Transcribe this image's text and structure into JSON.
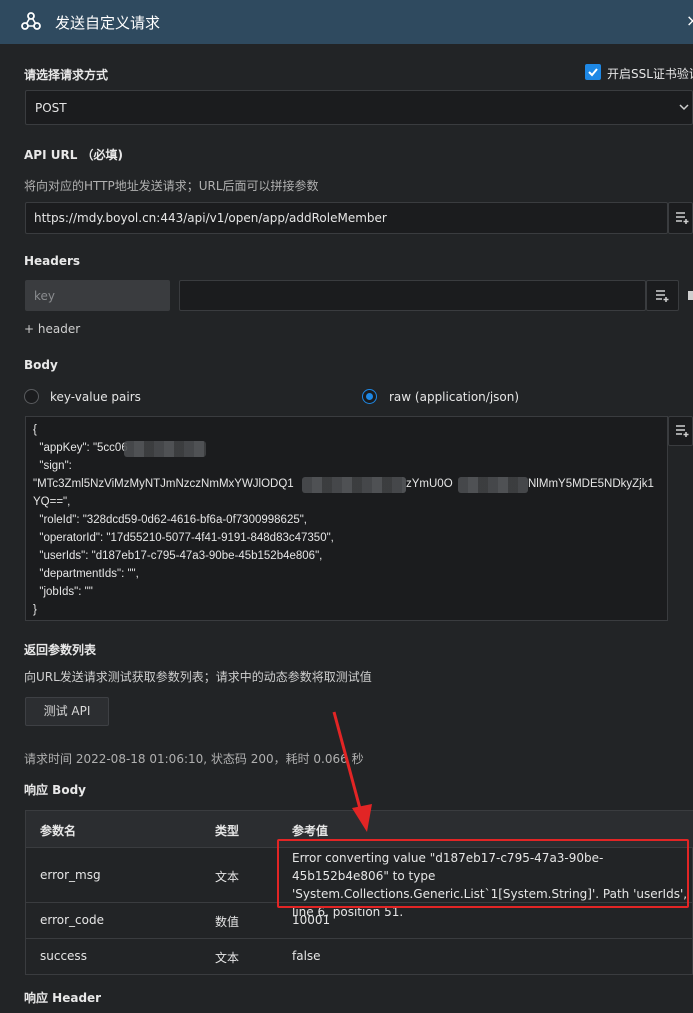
{
  "header": {
    "title": "发送自定义请求",
    "close": "×"
  },
  "method": {
    "label": "请选择请求方式",
    "value": "POST",
    "ssl_label": "开启SSL证书验证",
    "ssl_checked": true
  },
  "api_url": {
    "label": "API URL （必填)",
    "hint": "将向对应的HTTP地址发送请求；URL后面可以拼接参数",
    "value": "https://mdy.boyol.cn:443/api/v1/open/app/addRoleMember"
  },
  "headers": {
    "label": "Headers",
    "key_placeholder": "key",
    "add_label": "+ header"
  },
  "body": {
    "label": "Body",
    "option_kv": "key-value pairs",
    "option_raw": "raw (application/json)",
    "selected": "raw (application/json)",
    "lines": [
      "{",
      "  \"appKey\": \"5cc06",
      "  \"sign\":",
      "\"MTc3Zml5NzViMzMyNTJmNzczNmMxYWJlODQ1",
      "YQ==\",",
      "  \"roleId\": \"328dcd59-0d62-4616-bf6a-0f7300998625\",",
      "  \"operatorId\": \"17d55210-5077-4f41-9191-848d83c47350\",",
      "  \"userIds\": \"d187eb17-c795-47a3-90be-45b152b4e806\",",
      "  \"departmentIds\": \"\",",
      "  \"jobIds\": \"\"",
      "}"
    ],
    "sign_mid": "zYmU0O",
    "sign_end": "NlMmY5MDE5NDkyZjk1"
  },
  "response_params": {
    "label": "返回参数列表",
    "hint": "向URL发送请求测试获取参数列表；请求中的动态参数将取测试值",
    "test_button": "测试 API",
    "status": "请求时间 2022-08-18 01:06:10, 状态码 200，耗时 0.066 秒"
  },
  "response_body": {
    "label": "响应 Body",
    "columns": [
      "参数名",
      "类型",
      "参考值"
    ],
    "rows": [
      {
        "name": "error_msg",
        "type": "文本",
        "value": "Error converting value \"d187eb17-c795-47a3-90be-45b152b4e806\" to type 'System.Collections.Generic.List`1[System.String]'. Path 'userIds', line 6, position 51."
      },
      {
        "name": "error_code",
        "type": "数值",
        "value": "10001"
      },
      {
        "name": "success",
        "type": "文本",
        "value": "false"
      }
    ]
  },
  "response_header": {
    "label": "响应 Header"
  },
  "colors": {
    "accent": "#1e88e5",
    "header_bg": "#2f4a5f",
    "highlight": "#e22525"
  }
}
